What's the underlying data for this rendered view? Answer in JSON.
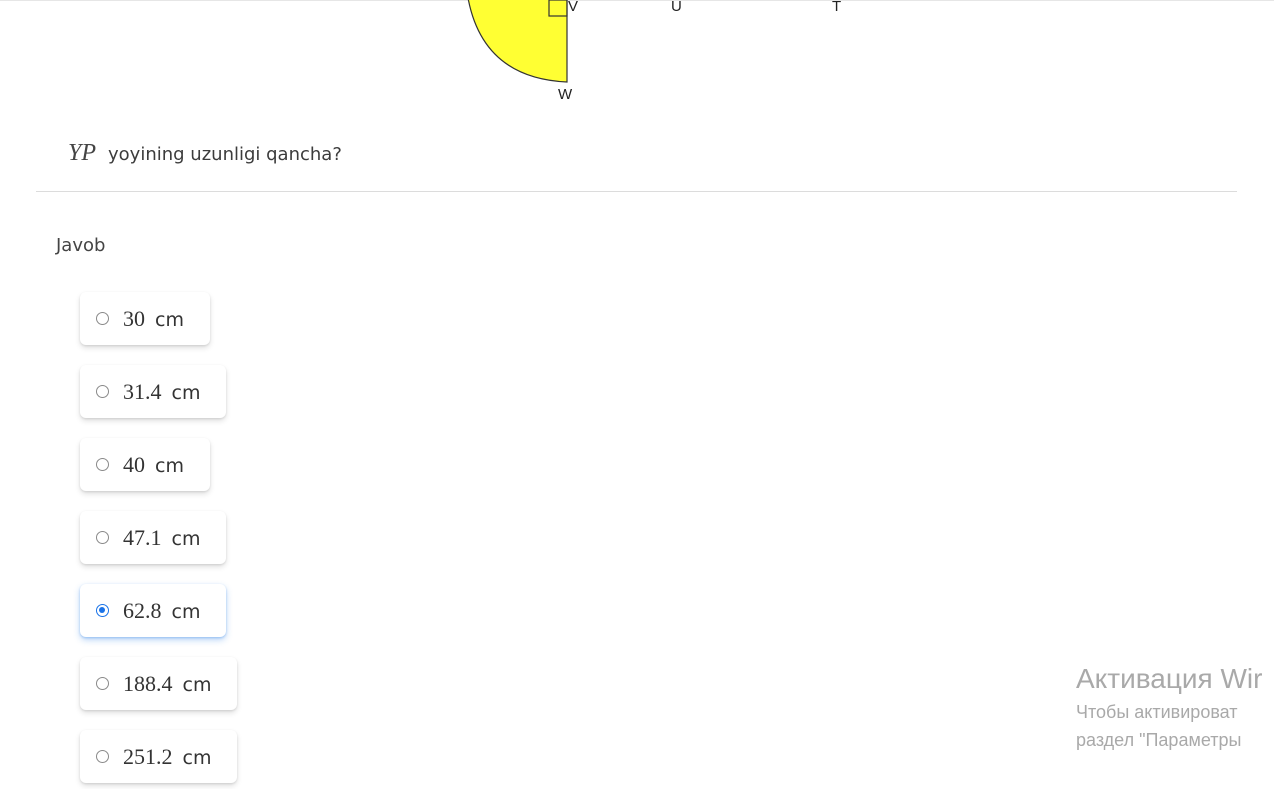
{
  "diagram": {
    "labels": [
      "V",
      "U",
      "T",
      "W"
    ],
    "fill_color": "#ffff33"
  },
  "question": {
    "math": "YP",
    "text": "yoyining uzunligi qancha?"
  },
  "answer": {
    "label": "Javob",
    "unit": "cm",
    "selected_index": 4,
    "options": [
      {
        "value": "30"
      },
      {
        "value": "31.4"
      },
      {
        "value": "40"
      },
      {
        "value": "47.1"
      },
      {
        "value": "62.8"
      },
      {
        "value": "188.4"
      },
      {
        "value": "251.2"
      }
    ]
  },
  "watermark": {
    "title": "Активация Wir",
    "line1": "Чтобы активироват",
    "line2": "раздел \"Параметры"
  },
  "colors": {
    "accent": "#1a73e8",
    "diagram_fill": "#ffff33"
  }
}
